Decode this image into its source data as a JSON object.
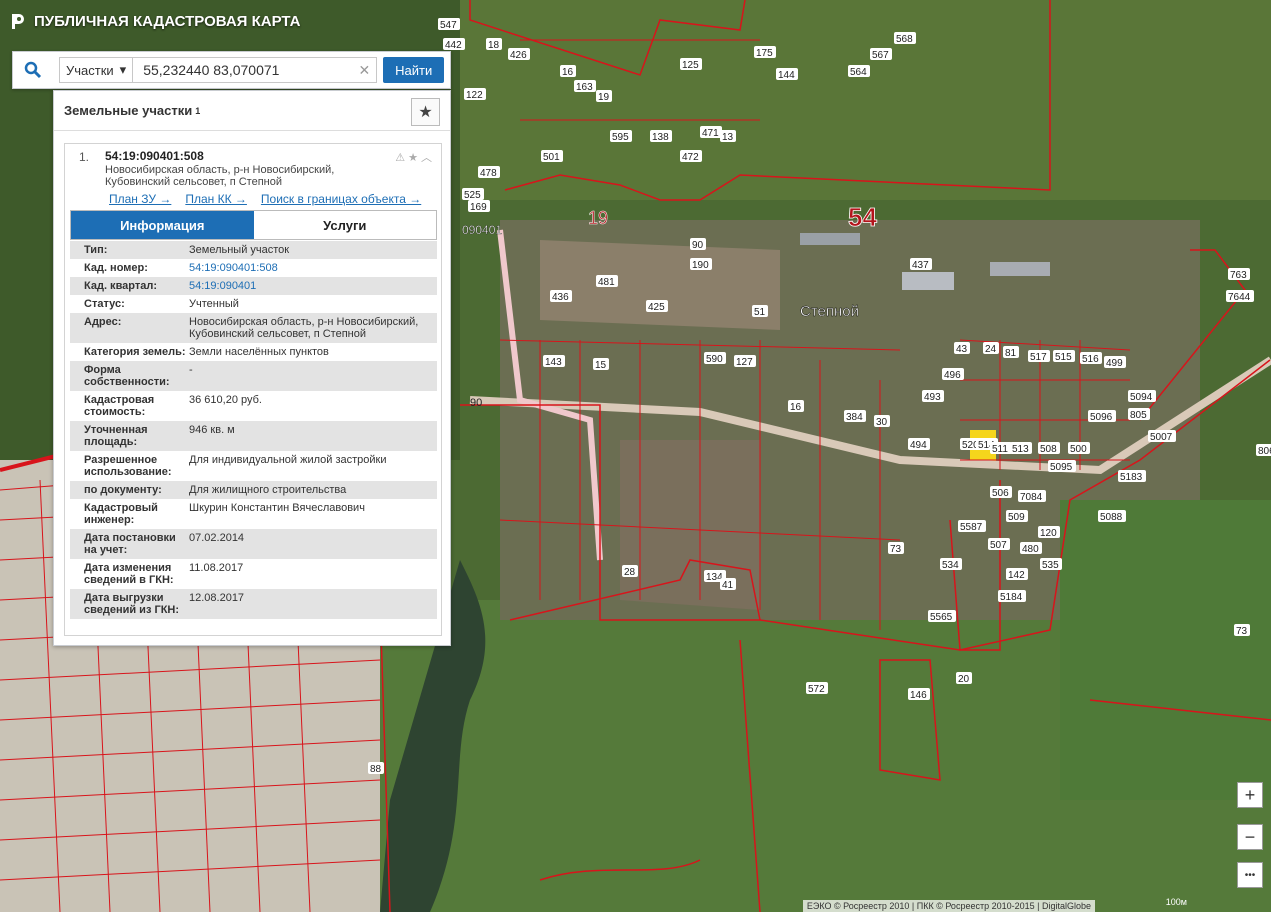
{
  "app": {
    "title": "ПУБЛИЧНАЯ КАДАСТРОВАЯ КАРТА"
  },
  "search": {
    "type_select": "Участки",
    "query": "55,232440 83,070071",
    "submit_label": "Найти"
  },
  "results_panel": {
    "title": "Земельные участки",
    "count": "1",
    "item": {
      "index": "1.",
      "cad_number": "54:19:090401:508",
      "address": "Новосибирская область, р-н Новосибирский, Кубовинский сельсовет, п Степной",
      "links": [
        "План ЗУ →",
        "План КК →",
        "Поиск в границах объекта →"
      ]
    },
    "tabs": [
      "Информация",
      "Услуги"
    ],
    "attributes": [
      {
        "label": "Тип:",
        "value": "Земельный участок"
      },
      {
        "label": "Кад. номер:",
        "value": "54:19:090401:508",
        "link": true
      },
      {
        "label": "Кад. квартал:",
        "value": "54:19:090401",
        "link": true
      },
      {
        "label": "Статус:",
        "value": "Учтенный"
      },
      {
        "label": "Адрес:",
        "value": "Новосибирская область, р-н Новосибирский, Кубовинский сельсовет, п Степной"
      },
      {
        "label": "Категория земель:",
        "value": "Земли населённых пунктов"
      },
      {
        "label": "Форма собственности:",
        "value": "-"
      },
      {
        "label": "Кадастровая стоимость:",
        "value": "36 610,20 руб."
      },
      {
        "label": "Уточненная площадь:",
        "value": "946 кв. м"
      },
      {
        "label": "Разрешенное использование:",
        "value": "Для индивидуальной жилой застройки"
      },
      {
        "label": "по документу:",
        "value": "Для жилищного строительства"
      },
      {
        "label": "Кадастровый инженер:",
        "value": "Шкурин Константин Вячеславович"
      },
      {
        "label": "Дата постановки на учет:",
        "value": "07.02.2014"
      },
      {
        "label": "Дата изменения сведений в ГКН:",
        "value": "11.08.2017"
      },
      {
        "label": "Дата выгрузки сведений из ГКН:",
        "value": "12.08.2017"
      }
    ]
  },
  "map": {
    "big_labels": [
      "19",
      "54"
    ],
    "place_name": "Степной",
    "quarter_label": "090401",
    "road_label": "90",
    "parcel_labels": [
      "453",
      "442",
      "18",
      "426",
      "16",
      "163",
      "19",
      "125",
      "175",
      "144",
      "564",
      "567",
      "568",
      "122",
      "595",
      "138",
      "472",
      "471",
      "13",
      "501",
      "478",
      "525",
      "169",
      "90",
      "190",
      "437",
      "436",
      "481",
      "425",
      "51",
      "143",
      "15",
      "590",
      "127",
      "16",
      "384",
      "30",
      "43",
      "24",
      "81",
      "517",
      "515",
      "516",
      "499",
      "496",
      "493",
      "494",
      "520",
      "514",
      "511",
      "513",
      "508",
      "500",
      "506",
      "509",
      "507",
      "480",
      "120",
      "142",
      "535",
      "534",
      "73",
      "28",
      "134",
      "41",
      "73",
      "572",
      "20",
      "146",
      "88",
      "805",
      "806",
      "763",
      "7644",
      "5007",
      "5094",
      "5095",
      "5096",
      "5183",
      "5184",
      "5565",
      "5587",
      "7084",
      "5088",
      "547"
    ],
    "zoom_in": "+",
    "zoom_out": "−",
    "more": "•••",
    "attribution": "ЕЭКО © Росреестр 2010 | ПКК © Росреестр 2010-2015 | DigitalGlobe",
    "scale": "100м",
    "highlight_color": "#f5d51c",
    "boundary_color": "#d8141b"
  }
}
